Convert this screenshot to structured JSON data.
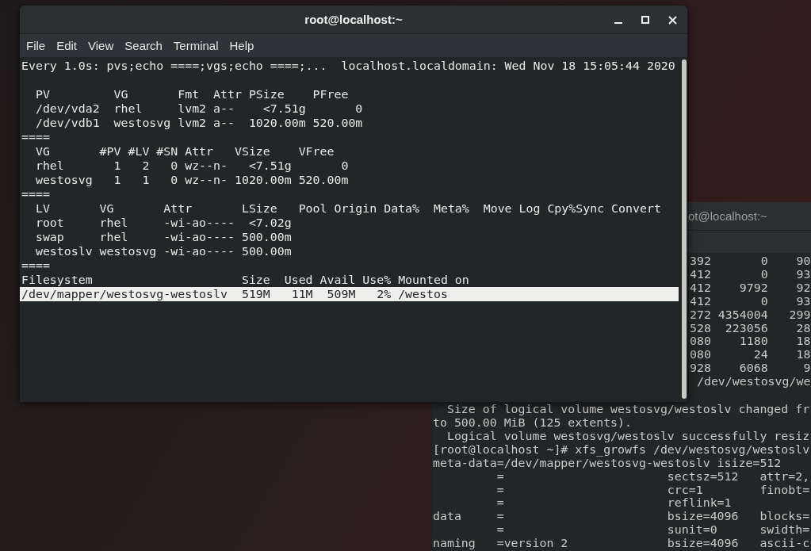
{
  "back_window": {
    "title": "ot@localhost:~",
    "lines": [
      {
        "kind": "clipped",
        "text": "392       0    90"
      },
      {
        "kind": "clipped",
        "text": "412       0    93"
      },
      {
        "kind": "clipped",
        "text": "412    9792    92"
      },
      {
        "kind": "clipped",
        "text": "412       0    93"
      },
      {
        "kind": "clipped",
        "text": "272 4354004   299"
      },
      {
        "kind": "clipped",
        "text": "528  223056    28"
      },
      {
        "kind": "clipped",
        "text": "080    1180    18"
      },
      {
        "kind": "clipped",
        "text": "080      24    18"
      },
      {
        "kind": "clipped",
        "text": "928    6068     9"
      },
      {
        "kind": "clipped",
        "text": " /dev/westosvg/we"
      },
      {
        "kind": "line",
        "text": "  Size of logical volume westosvg/westoslv changed fr"
      },
      {
        "kind": "line",
        "text": "to 500.00 MiB (125 extents)."
      },
      {
        "kind": "line",
        "text": "  Logical volume westosvg/westoslv successfully resiz"
      },
      {
        "kind": "line",
        "text": "[root@localhost ~]# xfs_growfs /dev/westosvg/westoslv"
      },
      {
        "kind": "line",
        "text": "meta-data=/dev/mapper/westosvg-westoslv isize=512"
      },
      {
        "kind": "line",
        "text": "         =                       sectsz=512   attr=2,"
      },
      {
        "kind": "line",
        "text": "         =                       crc=1        finobt="
      },
      {
        "kind": "line",
        "text": "         =                       reflink=1"
      },
      {
        "kind": "line",
        "text": "data     =                       bsize=4096   blocks="
      },
      {
        "kind": "line",
        "text": "         =                       sunit=0      swidth="
      },
      {
        "kind": "line",
        "text": "naming   =version 2              bsize=4096   ascii-c"
      }
    ]
  },
  "window": {
    "title": "root@localhost:~"
  },
  "menu": [
    "File",
    "Edit",
    "View",
    "Search",
    "Terminal",
    "Help"
  ],
  "terminal": {
    "header": "Every 1.0s: pvs;echo ====;vgs;echo ====;...  localhost.localdomain: Wed Nov 18 15:05:44 2020",
    "lines": [
      {
        "text": "  PV         VG       Fmt  Attr PSize    PFree",
        "selected": false
      },
      {
        "text": "  /dev/vda2  rhel     lvm2 a--    <7.51g       0",
        "selected": false
      },
      {
        "text": "  /dev/vdb1  westosvg lvm2 a--  1020.00m 520.00m",
        "selected": false
      },
      {
        "text": "====",
        "selected": false
      },
      {
        "text": "  VG       #PV #LV #SN Attr   VSize    VFree",
        "selected": false
      },
      {
        "text": "  rhel       1   2   0 wz--n-   <7.51g       0",
        "selected": false
      },
      {
        "text": "  westosvg   1   1   0 wz--n- 1020.00m 520.00m",
        "selected": false
      },
      {
        "text": "====",
        "selected": false
      },
      {
        "text": "  LV       VG       Attr       LSize   Pool Origin Data%  Meta%  Move Log Cpy%Sync Convert",
        "selected": false
      },
      {
        "text": "  root     rhel     -wi-ao----  <7.02g",
        "selected": false
      },
      {
        "text": "  swap     rhel     -wi-ao---- 500.00m",
        "selected": false
      },
      {
        "text": "  westoslv westosvg -wi-ao---- 500.00m",
        "selected": false
      },
      {
        "text": "====",
        "selected": false
      },
      {
        "text": "Filesystem                     Size  Used Avail Use% Mounted on",
        "selected": false
      },
      {
        "text": "/dev/mapper/westosvg-westoslv  519M   11M  509M   2% /westos",
        "selected": true
      }
    ]
  }
}
